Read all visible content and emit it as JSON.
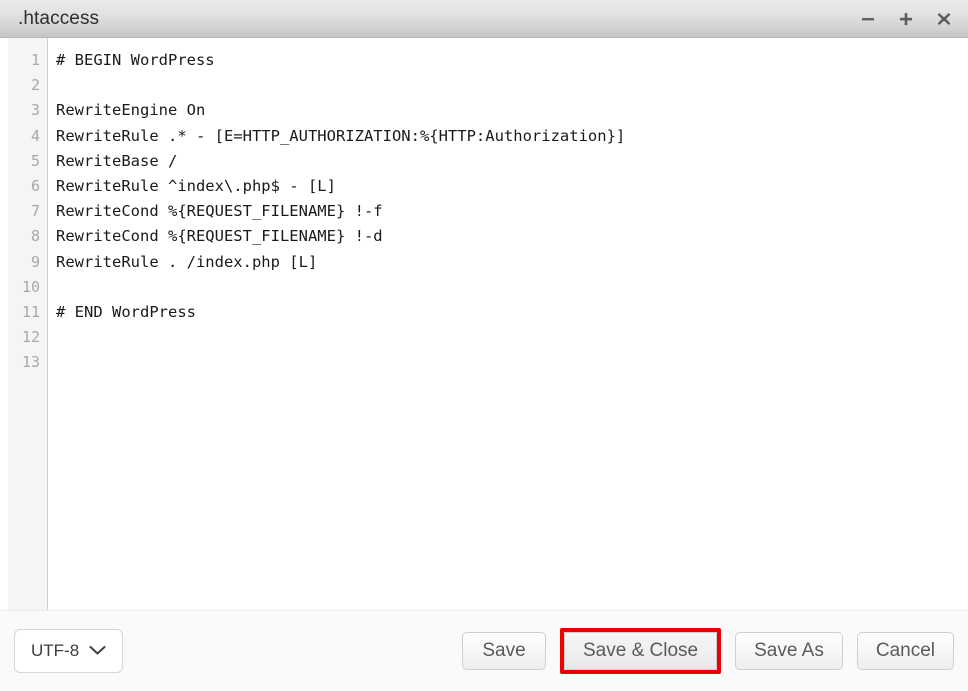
{
  "titlebar": {
    "title": ".htaccess",
    "controls": [
      {
        "name": "minimize-button",
        "glyph": "minus"
      },
      {
        "name": "maximize-button",
        "glyph": "plus"
      },
      {
        "name": "close-button",
        "glyph": "cross"
      }
    ]
  },
  "editor": {
    "line_numbers": [
      "1",
      "2",
      "3",
      "4",
      "5",
      "6",
      "7",
      "8",
      "9",
      "10",
      "11",
      "12",
      "13"
    ],
    "lines": [
      "# BEGIN WordPress",
      "",
      "RewriteEngine On",
      "RewriteRule .* - [E=HTTP_AUTHORIZATION:%{HTTP:Authorization}]",
      "RewriteBase /",
      "RewriteRule ^index\\.php$ - [L]",
      "RewriteCond %{REQUEST_FILENAME} !-f",
      "RewriteCond %{REQUEST_FILENAME} !-d",
      "RewriteRule . /index.php [L]",
      "",
      "# END WordPress",
      "",
      ""
    ]
  },
  "footer": {
    "encoding": {
      "value": "UTF-8",
      "icon": "chevron-down-icon"
    },
    "buttons": [
      {
        "label": "Save",
        "name": "save-button",
        "highlighted": false
      },
      {
        "label": "Save & Close",
        "name": "save-and-close-button",
        "highlighted": true
      },
      {
        "label": "Save As",
        "name": "save-as-button",
        "highlighted": false
      },
      {
        "label": "Cancel",
        "name": "cancel-button",
        "highlighted": false
      }
    ]
  },
  "colors": {
    "highlight": "#ee0000",
    "titlebar_top": "#eaeaea",
    "titlebar_bottom": "#c6c6c6",
    "gutter_bg": "#f5f5f5",
    "gutter_text": "#a8a8a8",
    "code_text": "#1a1a1a",
    "footer_bg": "#fafafa",
    "button_text": "#5a5a5a"
  }
}
